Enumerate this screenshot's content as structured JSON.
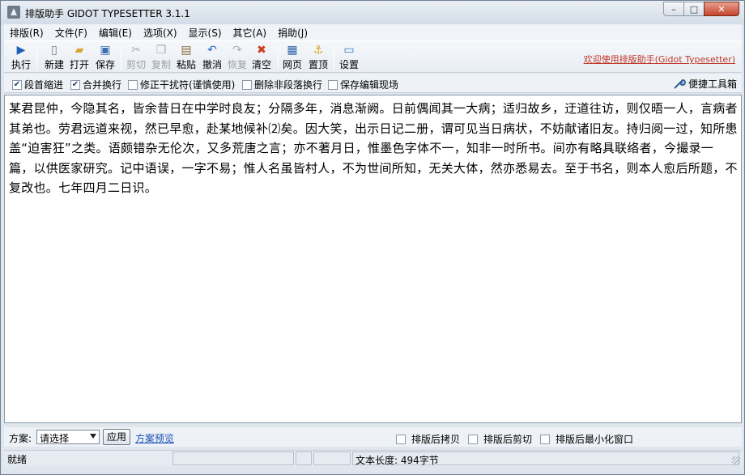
{
  "window": {
    "title": "排版助手 GIDOT TYPESETTER 3.1.1",
    "controls": {
      "minimize": "–",
      "maximize": "□",
      "close": "✕"
    }
  },
  "menu": [
    "排版(R)",
    "文件(F)",
    "编辑(E)",
    "选项(X)",
    "显示(S)",
    "其它(A)",
    "捐助(J)"
  ],
  "toolbar": {
    "buttons": [
      {
        "label": "执行",
        "icon": "play-icon",
        "glyph": "▶",
        "color": "#1f5fb8",
        "enabled": true
      },
      {
        "label": "新建",
        "icon": "new-file-icon",
        "glyph": "▯",
        "color": "#6d7884",
        "enabled": true
      },
      {
        "label": "打开",
        "icon": "open-folder-icon",
        "glyph": "▰",
        "color": "#d8a735",
        "enabled": true
      },
      {
        "label": "保存",
        "icon": "save-icon",
        "glyph": "▣",
        "color": "#3b6fb0",
        "enabled": true
      },
      {
        "label": "剪切",
        "icon": "cut-icon",
        "glyph": "✂",
        "color": "#555555",
        "enabled": false
      },
      {
        "label": "复制",
        "icon": "copy-icon",
        "glyph": "❐",
        "color": "#555555",
        "enabled": false
      },
      {
        "label": "粘贴",
        "icon": "paste-icon",
        "glyph": "▤",
        "color": "#8a6a3a",
        "enabled": true
      },
      {
        "label": "撤消",
        "icon": "undo-icon",
        "glyph": "↶",
        "color": "#2a6ac0",
        "enabled": true
      },
      {
        "label": "恢复",
        "icon": "redo-icon",
        "glyph": "↷",
        "color": "#555555",
        "enabled": false
      },
      {
        "label": "清空",
        "icon": "clear-icon",
        "glyph": "✖",
        "color": "#d23a1c",
        "enabled": true
      },
      {
        "label": "网页",
        "icon": "html-icon",
        "glyph": "▦",
        "color": "#2d63a8",
        "enabled": true
      },
      {
        "label": "置顶",
        "icon": "pin-icon",
        "glyph": "⚓",
        "color": "#d6a218",
        "enabled": true
      },
      {
        "label": "设置",
        "icon": "settings-monitor-icon",
        "glyph": "▭",
        "color": "#2b7bd0",
        "enabled": true
      }
    ],
    "welcome_link": "欢迎使用排版助手(Gidot Typesetter)"
  },
  "options": [
    {
      "label": "段首缩进",
      "checked": true
    },
    {
      "label": "合并换行",
      "checked": true
    },
    {
      "label": "修正干扰符(谨慎使用)",
      "checked": false
    },
    {
      "label": "删除非段落换行",
      "checked": false
    },
    {
      "label": "保存编辑现场",
      "checked": false
    }
  ],
  "tools_button": {
    "label": "便捷工具箱",
    "icon": "wrench-icon"
  },
  "editor": {
    "text": "某君昆仲，今隐其名，皆余昔日在中学时良友；分隔多年，消息渐阙。日前偶闻其一大病；适归故乡，迂道往访，则仅晤一人，言病者其弟也。劳君远道来视，然已早愈，赴某地候补⑵矣。因大笑，出示日记二册，谓可见当日病状，不妨献诸旧友。持归阅一过，知所患盖“迫害狂”之类。语颇错杂无伦次，又多荒唐之言；亦不著月日，惟墨色字体不一，知非一时所书。间亦有略具联络者，今撮录一篇，以供医家研究。记中语误，一字不易；惟人名虽皆村人，不为世间所知，无关大体，然亦悉易去。至于书名，则本人愈后所题，不复改也。七年四月二日识。"
  },
  "scheme": {
    "label": "方案:",
    "selected": "请选择",
    "apply": "应用",
    "preview": "方案预览",
    "after_options": [
      {
        "label": "排版后拷贝",
        "checked": false
      },
      {
        "label": "排版后剪切",
        "checked": false
      },
      {
        "label": "排版后最小化窗口",
        "checked": false
      }
    ]
  },
  "status": {
    "ready": "就绪",
    "text_length": "文本长度: 494字节"
  }
}
